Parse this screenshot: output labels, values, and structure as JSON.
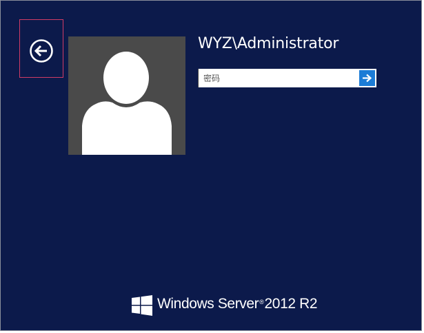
{
  "login": {
    "username": "WYZ\\Administrator",
    "password_placeholder": "密码",
    "password_value": ""
  },
  "icons": {
    "back": "back-arrow-icon",
    "submit": "right-arrow-icon",
    "avatar": "user-silhouette-icon",
    "logo": "windows-logo-icon"
  },
  "branding": {
    "product_name": "Windows Server",
    "registered_mark": "®",
    "version": "2012 R2"
  },
  "colors": {
    "background": "#0c1a4b",
    "avatar_bg": "#4a4a4a",
    "submit_button": "#1c7cd6",
    "highlight_border": "#d23c66"
  }
}
